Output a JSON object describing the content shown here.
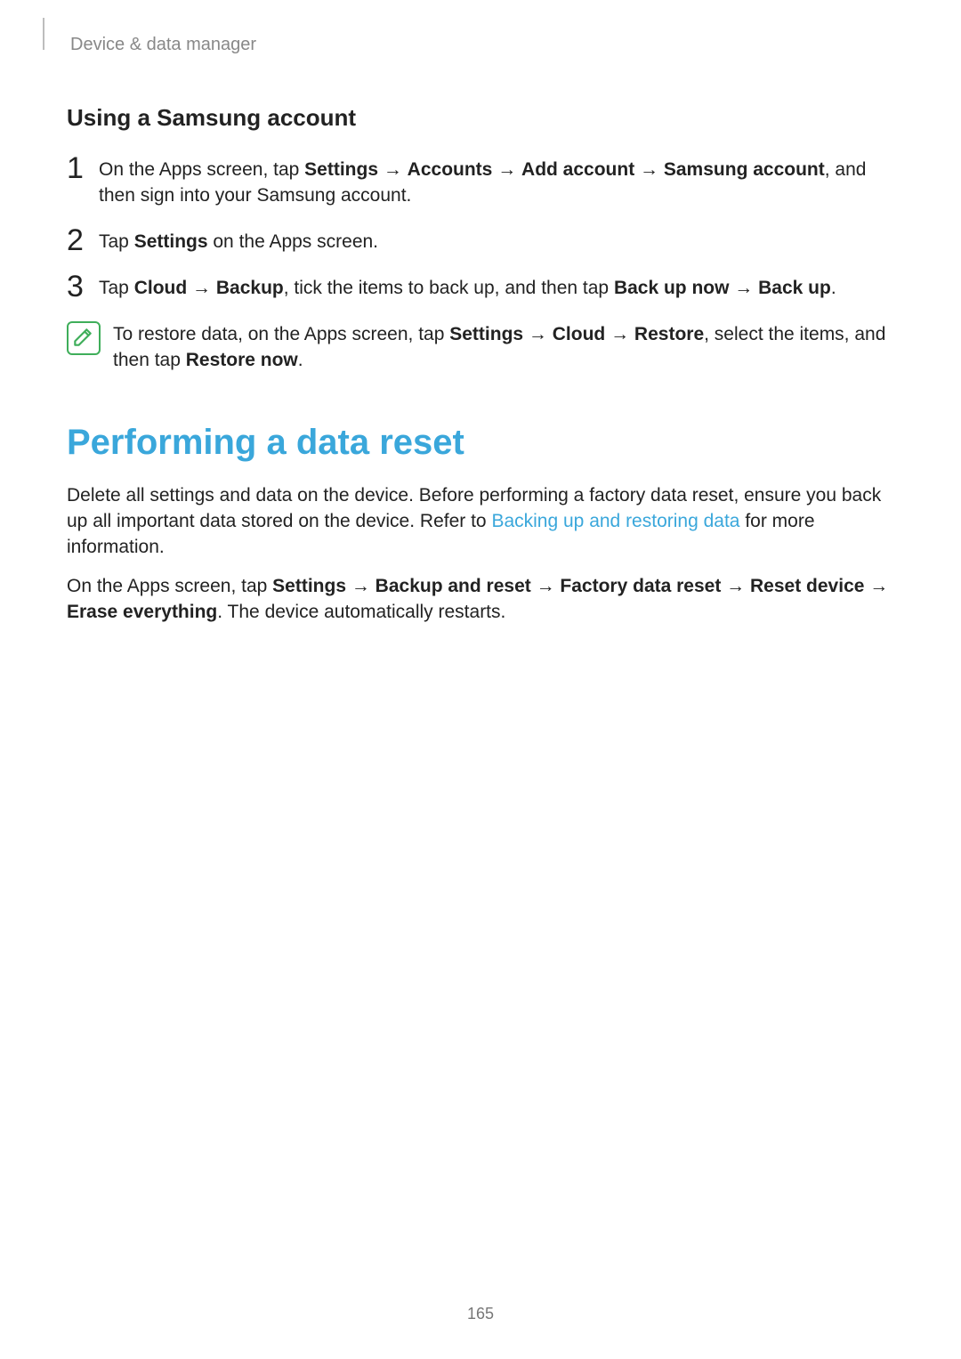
{
  "header": {
    "label": "Device & data manager"
  },
  "subheading": "Using a Samsung account",
  "arrow": " → ",
  "steps": [
    {
      "num": "1",
      "parts": [
        {
          "t": "On the Apps screen, tap "
        },
        {
          "t": "Settings",
          "b": true
        },
        {
          "arrow": true
        },
        {
          "t": "Accounts",
          "b": true
        },
        {
          "arrow": true
        },
        {
          "t": "Add account",
          "b": true
        },
        {
          "arrow": true
        },
        {
          "t": "Samsung account",
          "b": true
        },
        {
          "t": ", and then sign into your Samsung account."
        }
      ]
    },
    {
      "num": "2",
      "parts": [
        {
          "t": "Tap "
        },
        {
          "t": "Settings",
          "b": true
        },
        {
          "t": " on the Apps screen."
        }
      ]
    },
    {
      "num": "3",
      "parts": [
        {
          "t": "Tap "
        },
        {
          "t": "Cloud",
          "b": true
        },
        {
          "arrow": true
        },
        {
          "t": "Backup",
          "b": true
        },
        {
          "t": ", tick the items to back up, and then tap "
        },
        {
          "t": "Back up now",
          "b": true
        },
        {
          "arrow": true
        },
        {
          "t": "Back up",
          "b": true
        },
        {
          "t": "."
        }
      ]
    }
  ],
  "note": {
    "parts": [
      {
        "t": "To restore data, on the Apps screen, tap "
      },
      {
        "t": "Settings",
        "b": true
      },
      {
        "arrow": true
      },
      {
        "t": "Cloud",
        "b": true
      },
      {
        "arrow": true
      },
      {
        "t": "Restore",
        "b": true
      },
      {
        "t": ", select the items, and then tap "
      },
      {
        "t": "Restore now",
        "b": true
      },
      {
        "t": "."
      }
    ]
  },
  "section_title": "Performing a data reset",
  "paragraphs": [
    {
      "parts": [
        {
          "t": "Delete all settings and data on the device. Before performing a factory data reset, ensure you back up all important data stored on the device. Refer to "
        },
        {
          "t": "Backing up and restoring data",
          "link": true
        },
        {
          "t": " for more information."
        }
      ]
    },
    {
      "parts": [
        {
          "t": "On the Apps screen, tap "
        },
        {
          "t": "Settings",
          "b": true
        },
        {
          "arrow": true
        },
        {
          "t": "Backup and reset",
          "b": true
        },
        {
          "arrow": true
        },
        {
          "t": "Factory data reset",
          "b": true
        },
        {
          "arrow": true
        },
        {
          "t": "Reset device",
          "b": true
        },
        {
          "arrow": true
        },
        {
          "t": "Erase everything",
          "b": true
        },
        {
          "t": ". The device automatically restarts."
        }
      ]
    }
  ],
  "page_number": "165"
}
